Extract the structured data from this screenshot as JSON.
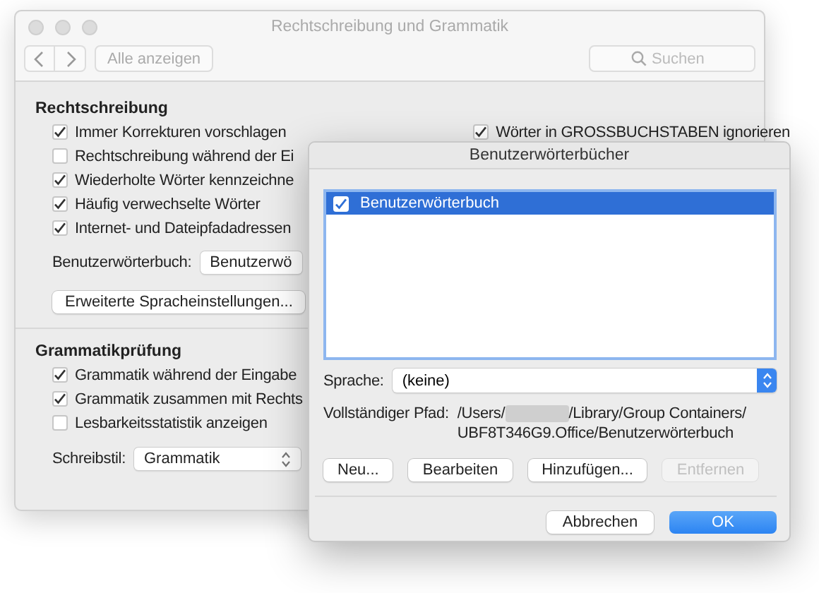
{
  "main_window": {
    "title": "Rechtschreibung und Grammatik",
    "toolbar": {
      "show_all": "Alle anzeigen",
      "search": {
        "placeholder": "Suchen"
      }
    },
    "spelling": {
      "heading": "Rechtschreibung",
      "options_left": [
        {
          "label": "Immer Korrekturen vorschlagen",
          "checked": true
        },
        {
          "label": "Rechtschreibung während der Ei",
          "checked": false
        },
        {
          "label": "Wiederholte Wörter kennzeichne",
          "checked": true
        },
        {
          "label": "Häufig verwechselte Wörter",
          "checked": true
        },
        {
          "label": "Internet- und Dateipfadadressen",
          "checked": true
        }
      ],
      "options_right": [
        {
          "label": "Wörter in GROSSBUCHSTABEN ignorieren",
          "checked": true
        }
      ],
      "dictionary_label": "Benutzerwörterbuch:",
      "dictionary_value": "Benutzerwö",
      "advanced_button": "Erweiterte Spracheinstellungen..."
    },
    "grammar": {
      "heading": "Grammatikprüfung",
      "options": [
        {
          "label": "Grammatik während der Eingabe",
          "checked": true
        },
        {
          "label": "Grammatik zusammen mit Rechts",
          "checked": true
        },
        {
          "label": "Lesbarkeitsstatistik anzeigen",
          "checked": false
        }
      ],
      "style_label": "Schreibstil:",
      "style_value": "Grammatik"
    }
  },
  "dialog": {
    "title": "Benutzerwörterbücher",
    "dictionaries": [
      {
        "label": "Benutzerwörterbuch",
        "checked": true,
        "selected": true
      }
    ],
    "language_label": "Sprache:",
    "language_value": "(keine)",
    "path_label": "Vollständiger Pfad:",
    "path_start": "/Users/",
    "path_rest": "/Library/Group Containers/",
    "path_line_2": "UBF8T346G9.Office/Benutzerwörterbuch",
    "actions": [
      {
        "label": "Neu...",
        "disabled": false
      },
      {
        "label": "Bearbeiten",
        "disabled": false
      },
      {
        "label": "Hinzufügen...",
        "disabled": false
      },
      {
        "label": "Entfernen",
        "disabled": true
      }
    ],
    "buttons": [
      {
        "label": "Abbrechen",
        "default": false
      },
      {
        "label": "OK",
        "default": true
      }
    ]
  }
}
